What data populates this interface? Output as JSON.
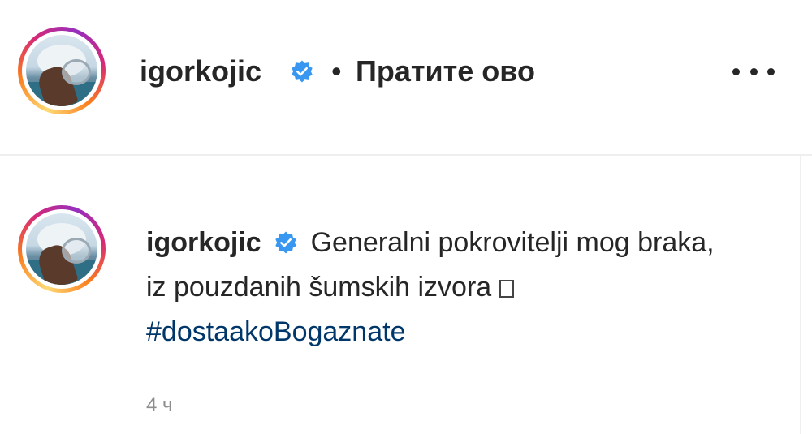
{
  "header": {
    "username": "igorkojic",
    "separator": "•",
    "follow_label": "Пратите ово",
    "more_icon": "more-horizontal-icon"
  },
  "caption": {
    "username": "igorkojic",
    "text": "Generalni pokrovitelji mog braka, iz pouzdanih šumskih izvora",
    "hashtag": "#dostaakoBogaznate"
  },
  "meta": {
    "timestamp": "4 ч"
  },
  "colors": {
    "verified": "#3897f0",
    "hashtag": "#00376b",
    "text": "#262626",
    "muted": "#8e8e8e"
  }
}
